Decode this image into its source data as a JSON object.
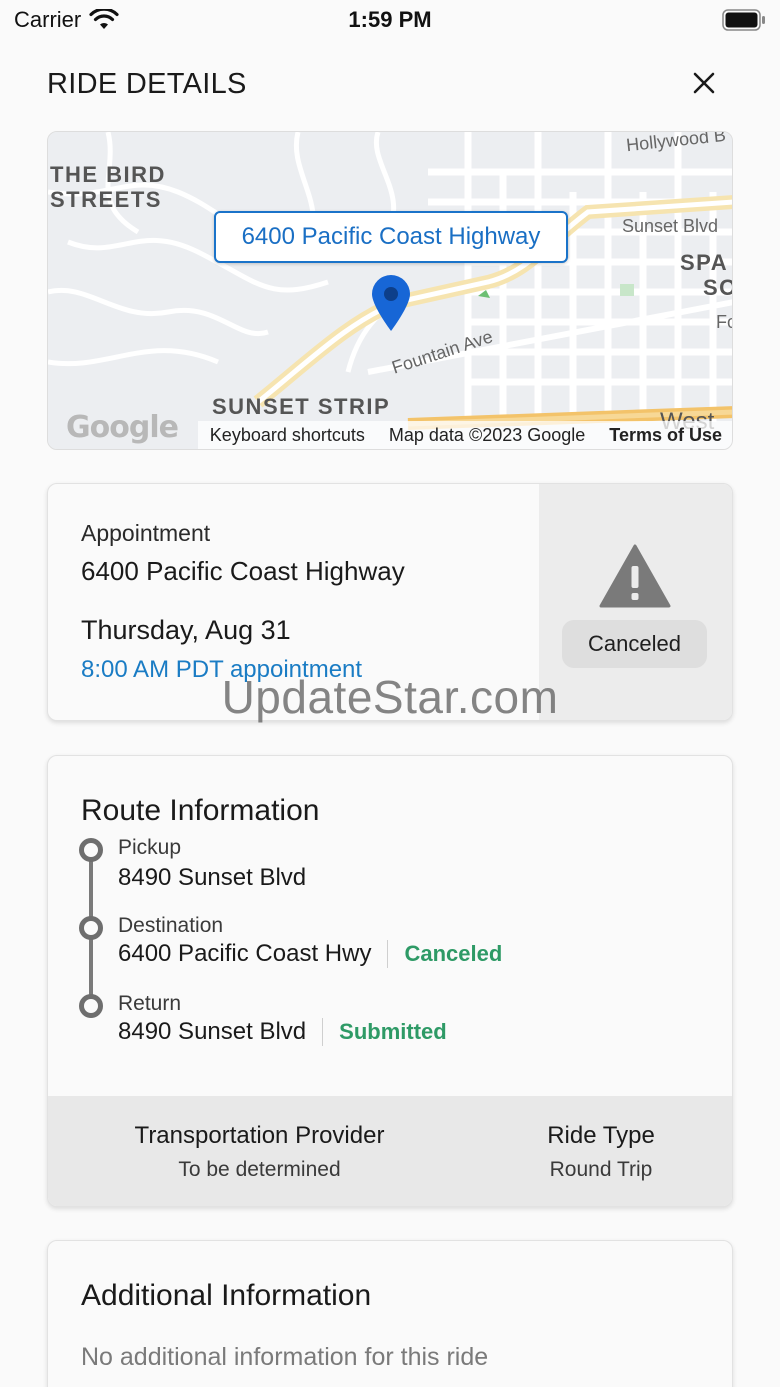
{
  "status_bar": {
    "carrier": "Carrier",
    "time": "1:59 PM"
  },
  "header": {
    "title": "RIDE DETAILS"
  },
  "map": {
    "destination_label": "6400 Pacific Coast Highway",
    "places": {
      "bird_streets_line1": "THE BIRD",
      "bird_streets_line2": "STREETS",
      "sunset_strip": "SUNSET STRIP",
      "spa_line1": "SPA",
      "spa_line2": "SO"
    },
    "streets": {
      "hollywood": "Hollywood B",
      "sunset_blvd": "Sunset Blvd",
      "fountain_ave": "Fountain Ave",
      "west": "West",
      "fo": "Fo"
    },
    "google_logo": "Google",
    "footer": {
      "keyboard_shortcuts": "Keyboard shortcuts",
      "map_data": "Map data ©2023 Google",
      "terms": "Terms of Use"
    }
  },
  "appointment": {
    "heading": "Appointment",
    "address": "6400 Pacific Coast Highway",
    "date": "Thursday, Aug 31",
    "time": "8:00 AM PDT appointment",
    "status": "Canceled",
    "status_icon": "warning-icon"
  },
  "watermark": "UpdateStar.com",
  "route": {
    "title": "Route Information",
    "stops": [
      {
        "label": "Pickup",
        "address": "8490 Sunset Blvd",
        "status": ""
      },
      {
        "label": "Destination",
        "address": "6400 Pacific Coast Hwy",
        "status": "Canceled"
      },
      {
        "label": "Return",
        "address": "8490 Sunset Blvd",
        "status": "Submitted"
      }
    ],
    "provider_heading": "Transportation Provider",
    "provider_value": "To be determined",
    "ride_type_heading": "Ride Type",
    "ride_type_value": "Round Trip"
  },
  "additional": {
    "title": "Additional Information",
    "text": "No additional information for this ride"
  },
  "colors": {
    "accent_blue": "#1a73c9",
    "status_green": "#2e9a66",
    "pin_blue": "#1766d6"
  }
}
